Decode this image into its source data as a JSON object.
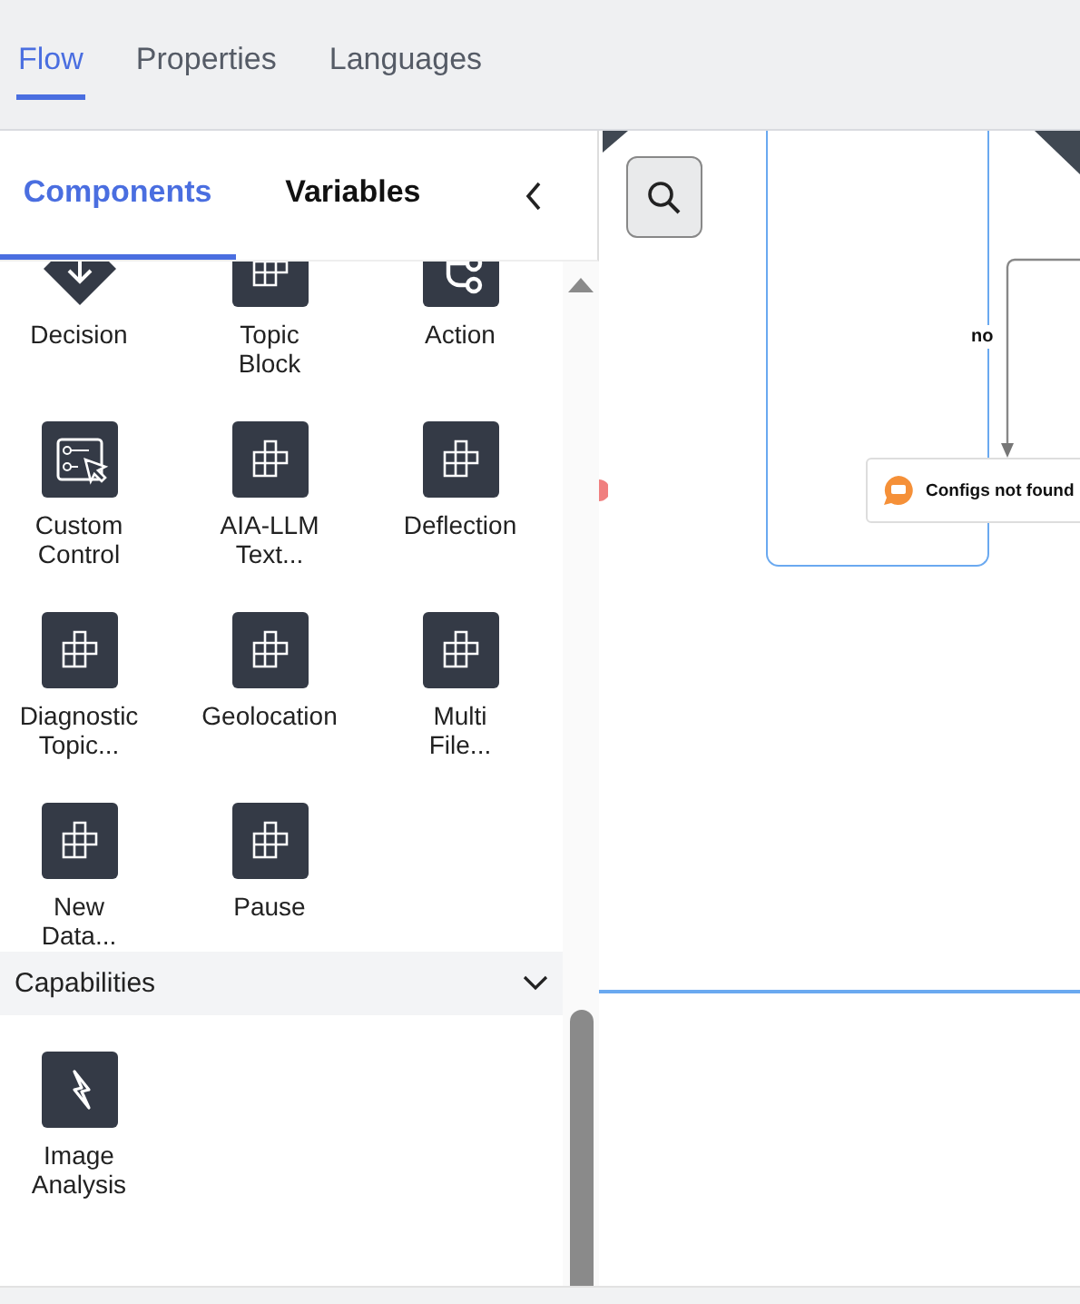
{
  "tabs": [
    {
      "label": "Flow",
      "selected": true
    },
    {
      "label": "Properties",
      "selected": false
    },
    {
      "label": "Languages",
      "selected": false
    }
  ],
  "panel": {
    "tabs": [
      {
        "label": "Components",
        "selected": true
      },
      {
        "label": "Variables",
        "selected": false
      }
    ],
    "components": [
      {
        "label": "Decision",
        "kind": "decision"
      },
      {
        "label": "Topic\nBlock",
        "kind": "block"
      },
      {
        "label": "Action",
        "kind": "action"
      },
      {
        "label": "Custom\nControl",
        "kind": "control"
      },
      {
        "label": "AIA-LLM\nText...",
        "kind": "block"
      },
      {
        "label": "Deflection",
        "kind": "block"
      },
      {
        "label": "Diagnostic\nTopic...",
        "kind": "block"
      },
      {
        "label": "Geolocation",
        "kind": "block"
      },
      {
        "label": "Multi\nFile...",
        "kind": "block"
      },
      {
        "label": "New\nData...",
        "kind": "block"
      },
      {
        "label": "Pause",
        "kind": "block"
      }
    ],
    "capabilities": {
      "title": "Capabilities",
      "expanded": true,
      "items": [
        {
          "label": "Image\nAnalysis",
          "kind": "bolt"
        }
      ]
    }
  },
  "canvas": {
    "edge_label": "no",
    "node": {
      "label": "Configs not found"
    }
  }
}
